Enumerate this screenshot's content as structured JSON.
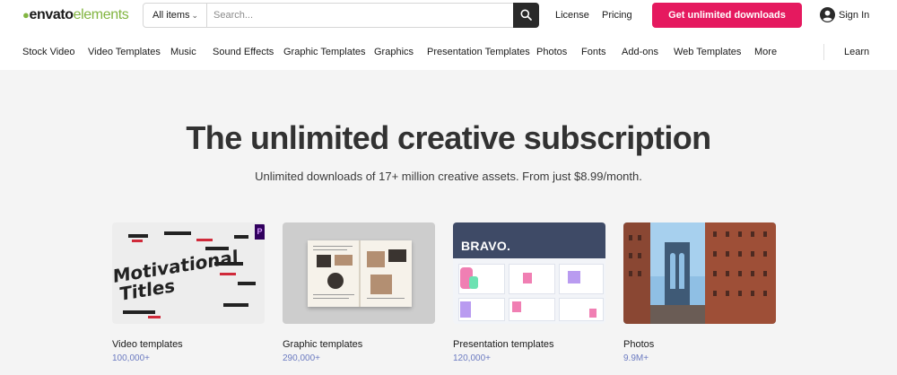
{
  "header": {
    "logo": {
      "brand": "envato",
      "product": "elements"
    },
    "search": {
      "scope_selected": "All items",
      "placeholder": "Search..."
    },
    "links": {
      "license": "License",
      "pricing": "Pricing"
    },
    "cta_label": "Get unlimited downloads",
    "signin_label": "Sign In"
  },
  "categories": {
    "items": [
      "Stock Video",
      "Video Templates",
      "Music",
      "Sound Effects",
      "Graphic Templates",
      "Graphics",
      "Presentation Templates",
      "Photos",
      "Fonts",
      "Add-ons",
      "Web Templates",
      "More"
    ],
    "learn": "Learn"
  },
  "hero": {
    "title": "The unlimited creative subscription",
    "subtitle": "Unlimited downloads of 17+ million creative assets. From just $8.99/month."
  },
  "cards": [
    {
      "label": "Video templates",
      "count": "100,000+",
      "art": {
        "line1": "Motivational",
        "line2": "Titles",
        "badge": "P"
      }
    },
    {
      "label": "Graphic templates",
      "count": "290,000+"
    },
    {
      "label": "Presentation templates",
      "count": "120,000+",
      "art": {
        "heading": "BRAVO."
      }
    },
    {
      "label": "Photos",
      "count": "9.9M+"
    }
  ],
  "colors": {
    "accent": "#e5195f",
    "brand_green": "#82b541",
    "count_blue": "#6c7bc1",
    "page_bg": "#f4f4f4"
  }
}
